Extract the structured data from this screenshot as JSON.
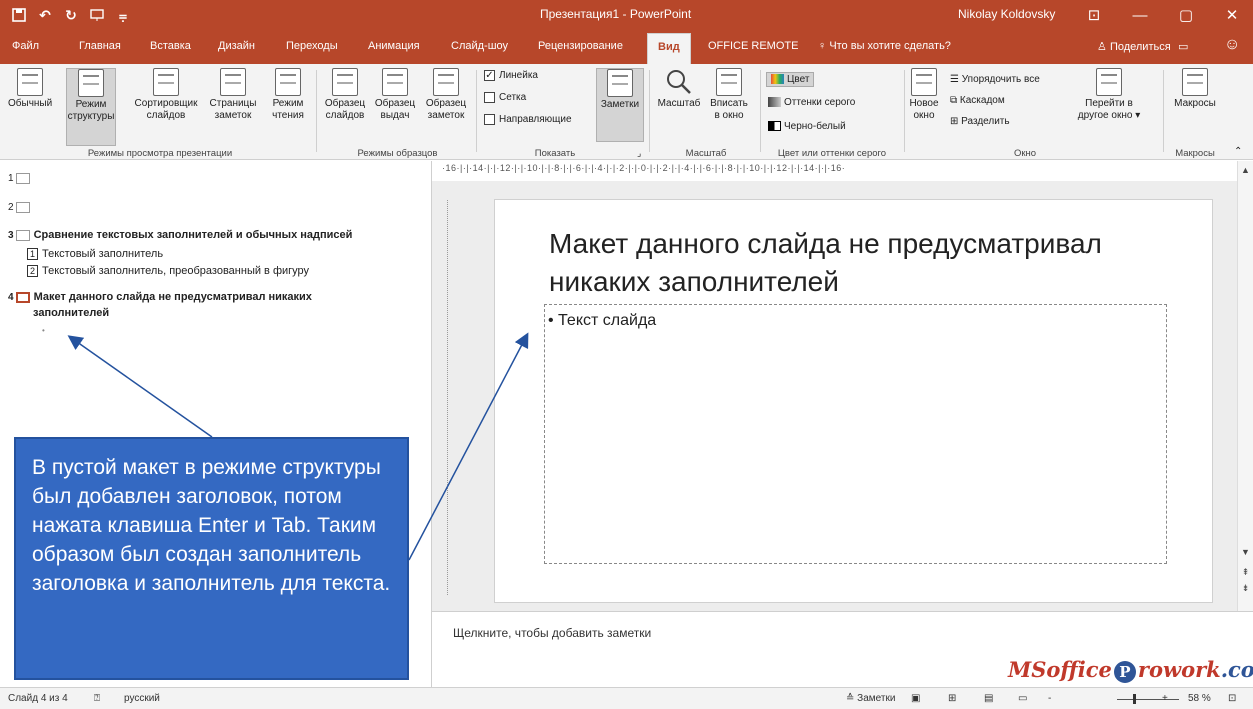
{
  "titlebar": {
    "doc_title": "Презентация1 - PowerPoint",
    "user": "Nikolay Koldovsky",
    "save_icon": "save-icon",
    "undo_icon": "undo-icon",
    "redo_icon": "redo-icon",
    "present_icon": "present-from-start-icon",
    "minimize": "—",
    "restore": "▢",
    "close": "✕",
    "ribbon_display": "⊡"
  },
  "tabs": [
    "Файл",
    "Главная",
    "Вставка",
    "Дизайн",
    "Переходы",
    "Анимация",
    "Слайд-шоу",
    "Рецензирование",
    "Вид",
    "OFFICE REMOTE"
  ],
  "active_tab": "Вид",
  "tell_me": "Что вы хотите сделать?",
  "share": "Поделиться",
  "ribbon": {
    "views": {
      "normal": "Обычный",
      "outline_1": "Режим",
      "outline_2": "структуры",
      "sorter_1": "Сортировщик",
      "sorter_2": "слайдов",
      "notes_1": "Страницы",
      "notes_2": "заметок",
      "reading_1": "Режим",
      "reading_2": "чтения",
      "group": "Режимы просмотра презентации"
    },
    "masters": {
      "slide_1": "Образец",
      "slide_2": "слайдов",
      "handout_1": "Образец",
      "handout_2": "выдач",
      "notes_1": "Образец",
      "notes_2": "заметок",
      "group": "Режимы образцов"
    },
    "show": {
      "ruler": "Линейка",
      "grid": "Сетка",
      "guides": "Направляющие",
      "notes": "Заметки",
      "group": "Показать"
    },
    "zoom": {
      "zoom": "Масштаб",
      "fit_1": "Вписать",
      "fit_2": "в окно",
      "group": "Масштаб"
    },
    "color": {
      "color": "Цвет",
      "grayscale": "Оттенки серого",
      "bw": "Черно-белый",
      "group": "Цвет или оттенки серого"
    },
    "window": {
      "new_1": "Новое",
      "new_2": "окно",
      "arrange": "Упорядочить все",
      "cascade": "Каскадом",
      "split": "Разделить",
      "switch_1": "Перейти в",
      "switch_2": "другое окно ▾",
      "group": "Окно"
    },
    "macros": {
      "macros": "Макросы",
      "group": "Макросы"
    }
  },
  "outline": {
    "n1": "1",
    "n2": "2",
    "n3": "3",
    "n4": "4",
    "slide3_title": "Сравнение текстовых заполнителей и обычных надписей",
    "slide3_sub1_num": "1",
    "slide3_sub1": "Текстовый заполнитель",
    "slide3_sub2_num": "2",
    "slide3_sub2": "Текстовый заполнитель, преобразованный в фигуру",
    "slide4_line1": "Макет данного слайда не предусматривал никаких",
    "slide4_line2": "заполнителей",
    "bullet": "•"
  },
  "callout": "В пустой макет в режиме структуры был добавлен заголовок, потом нажата клавиша Enter и Tab. Таким образом был создан заполнитель заголовка и заполнитель для текста.",
  "ruler": "·16·|·|·14·|·|·12·|·|·10·|·|·8·|·|·6·|·|·4·|·|·2·|·|·0·|·|·2·|·|·4·|·|·6·|·|·8·|·|·10·|·|·12·|·|·14·|·|·16·",
  "slide": {
    "title": "Макет данного слайда не предусматривал никаких заполнителей",
    "body": "• Текст слайда"
  },
  "notes_placeholder": "Щелкните, чтобы добавить заметки",
  "logo": {
    "part1": "MSoffice",
    "p": "P",
    "part2": "rowork",
    "domain": ".com"
  },
  "statusbar": {
    "slide_of": "Слайд 4 из 4",
    "language": "русский",
    "notes": "Заметки",
    "zoom": "58 %",
    "zoom_level": 0.58,
    "minus": "-",
    "plus": "+"
  },
  "colors": {
    "accent": "#B7472A",
    "callout": "#3469C2"
  }
}
